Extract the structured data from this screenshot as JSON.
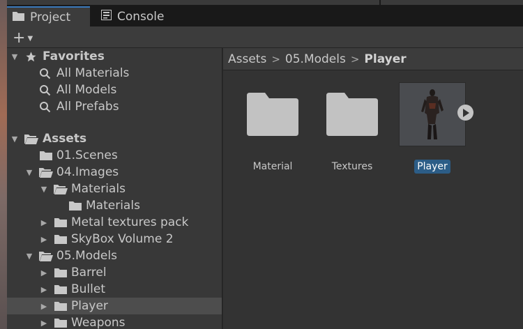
{
  "tabs": {
    "project": "Project",
    "console": "Console"
  },
  "toolbar": {
    "add_label": "+"
  },
  "tree": {
    "favorites": {
      "label": "Favorites",
      "items": [
        "All Materials",
        "All Models",
        "All Prefabs"
      ]
    },
    "assets": {
      "label": "Assets",
      "items": [
        {
          "label": "01.Scenes"
        },
        {
          "label": "04.Images"
        },
        {
          "label": "Materials"
        },
        {
          "label": "Materials"
        },
        {
          "label": "Metal textures pack"
        },
        {
          "label": "SkyBox Volume 2"
        },
        {
          "label": "05.Models"
        },
        {
          "label": "Barrel"
        },
        {
          "label": "Bullet"
        },
        {
          "label": "Player"
        },
        {
          "label": "Weapons"
        }
      ]
    }
  },
  "breadcrumb": [
    "Assets",
    "05.Models",
    "Player"
  ],
  "assets_grid": [
    {
      "name": "Material",
      "type": "folder"
    },
    {
      "name": "Textures",
      "type": "folder"
    },
    {
      "name": "Player",
      "type": "model",
      "selected": true
    }
  ],
  "colors": {
    "accent": "#3a79bb",
    "selection": "#2c5d87",
    "folder": "#c2c2c2"
  }
}
